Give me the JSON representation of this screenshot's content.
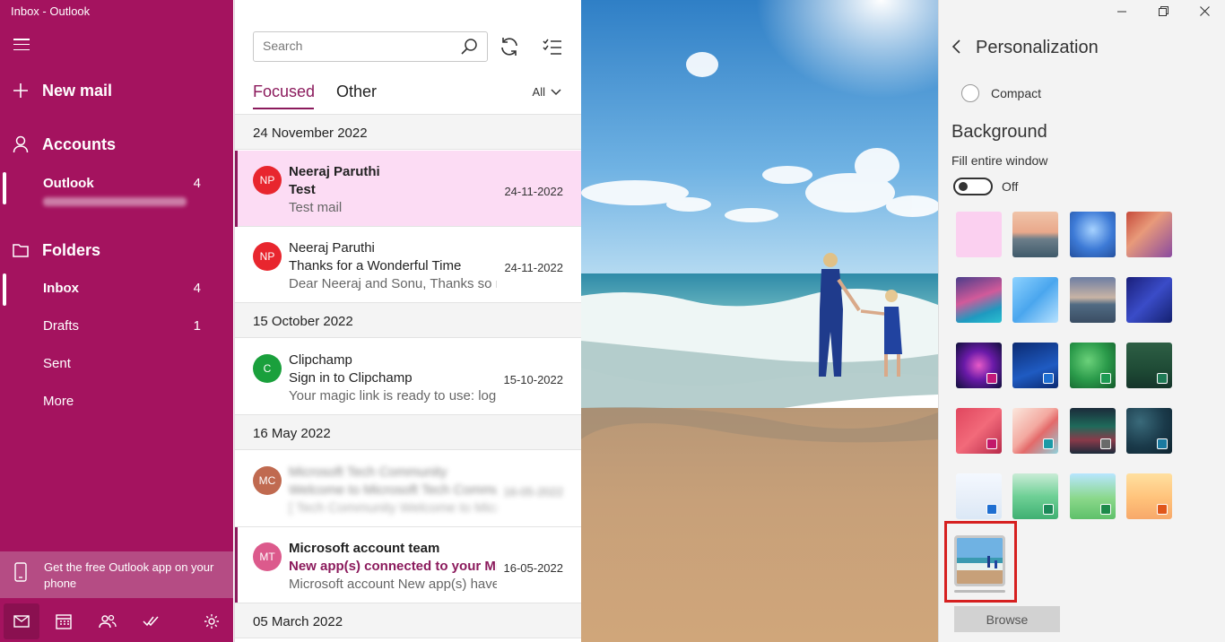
{
  "sidebar": {
    "title": "Inbox - Outlook",
    "new_mail": "New mail",
    "accounts": "Accounts",
    "account": {
      "name": "Outlook",
      "count": "4"
    },
    "folders_label": "Folders",
    "folders": [
      {
        "label": "Inbox",
        "count": "4"
      },
      {
        "label": "Drafts",
        "count": "1"
      },
      {
        "label": "Sent",
        "count": ""
      },
      {
        "label": "More",
        "count": ""
      }
    ],
    "promo": "Get the free Outlook app on your phone"
  },
  "list": {
    "search_placeholder": "Search",
    "tabs": {
      "focused": "Focused",
      "other": "Other"
    },
    "filter": "All",
    "groups": [
      {
        "date": "24 November 2022"
      },
      {
        "date": "15 October 2022"
      },
      {
        "date": "16 May 2022"
      },
      {
        "date": "05 March 2022"
      }
    ],
    "mails": [
      {
        "initials": "NP",
        "from": "Neeraj Paruthi",
        "subject": "Test",
        "preview": "Test mail",
        "date": "24-11-2022",
        "color": "#e8262e"
      },
      {
        "initials": "NP",
        "from": "Neeraj Paruthi",
        "subject": "Thanks for a Wonderful Time",
        "preview": "Dear Neeraj and Sonu, Thanks so much",
        "date": "24-11-2022",
        "color": "#e8262e"
      },
      {
        "initials": "C",
        "from": "Clipchamp",
        "subject": "Sign in to Clipchamp",
        "preview": "Your magic link is ready to use: log",
        "date": "15-10-2022",
        "color": "#1aa03c"
      },
      {
        "initials": "MC",
        "from": "Microsoft Tech Community",
        "subject": "Welcome to Microsoft Tech Community",
        "preview": "[ Tech Community Welcome to Microsoft",
        "date": "16-05-2022",
        "color": "#c06a50"
      },
      {
        "initials": "MT",
        "from": "Microsoft account team",
        "subject": "New app(s) connected to your Microsoft account",
        "preview": "Microsoft account New app(s) have",
        "date": "16-05-2022",
        "color": "#dc5a8c"
      }
    ]
  },
  "panel": {
    "title": "Personalization",
    "compact": "Compact",
    "background_heading": "Background",
    "fill_label": "Fill entire window",
    "toggle_state": "Off",
    "browse": "Browse"
  }
}
